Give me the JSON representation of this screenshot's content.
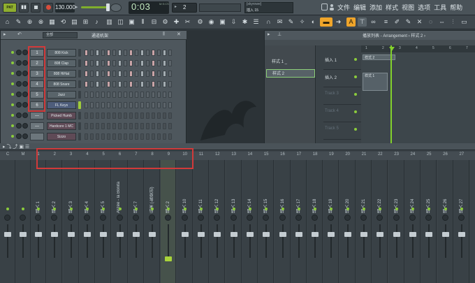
{
  "transport": {
    "pattern_mode": "PAT",
    "tempo": "130.000",
    "time": "0:03",
    "time_small": "21",
    "time_unit": "M:S:CS",
    "step": "2",
    "hint_user": "[skyrowe]",
    "hint_text": "插入 15"
  },
  "menu": [
    "文件",
    "编辑",
    "添加",
    "样式",
    "视图",
    "选项",
    "工具",
    "帮助"
  ],
  "rack": {
    "filter": "全部",
    "title": "通道机架",
    "channels": [
      {
        "num": "1",
        "name": "808 Kick"
      },
      {
        "num": "2",
        "name": "808 Clap"
      },
      {
        "num": "3",
        "name": "808 HiHat"
      },
      {
        "num": "4",
        "name": "808 Snare"
      },
      {
        "num": "5",
        "name": "Jazz"
      },
      {
        "num": "6",
        "name": "FL Keys"
      },
      {
        "num": "—",
        "name": "Picked Humb"
      },
      {
        "num": "—",
        "name": "Hardcore 1 MC"
      },
      {
        "num": "",
        "name": "Sizzo"
      }
    ]
  },
  "playlist": {
    "title": "播放列表 - Arrangement › 样式 2 ›",
    "patterns": [
      "样式 1 _",
      "样式 2"
    ],
    "tracks": [
      "插入 1",
      "插入 2",
      "Track 3",
      "Track 4",
      "Track 5"
    ],
    "ruler": [
      "1",
      "2",
      "3",
      "4",
      "5",
      "6",
      "7"
    ],
    "clips": [
      "样式 2",
      "样式 1"
    ]
  },
  "mixer": {
    "numbers": [
      "C",
      "M",
      "1",
      "2",
      "3",
      "4",
      "5",
      "6",
      "7",
      "8",
      "9",
      "10",
      "11",
      "12",
      "13",
      "14",
      "15",
      "16",
      "17",
      "18",
      "19",
      "20",
      "21",
      "22",
      "23",
      "24",
      "25",
      "26",
      "27"
    ],
    "strips": [
      "",
      "",
      "插入 1",
      "插入 2",
      "插入 3",
      "插入 4",
      "插入 5",
      "Alizée - la Bonita",
      "插入 7",
      "后来 (-陈奕迅)",
      "插入 2",
      "插入 10",
      "插入 11",
      "插入 12",
      "插入 13",
      "插入 14",
      "插入 15",
      "插入 16",
      "插入 17",
      "插入 18",
      "插入 19",
      "插入 20",
      "插入 21",
      "插入 22",
      "插入 23",
      "插入 24",
      "插入 25",
      "插入 26",
      "插入 27"
    ]
  }
}
